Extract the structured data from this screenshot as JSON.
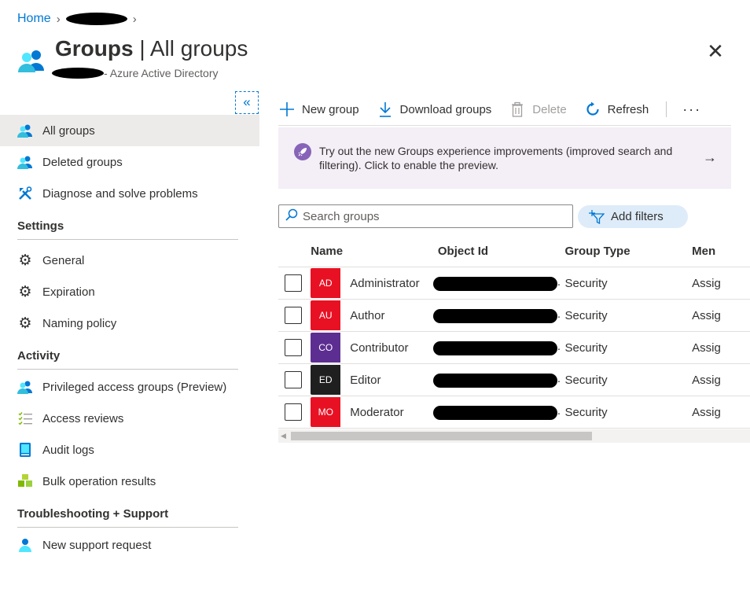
{
  "breadcrumb": {
    "home": "Home"
  },
  "header": {
    "title_bold": "Groups",
    "title_rest": " | All groups",
    "subtitle": " - Azure Active Directory"
  },
  "sidebar": {
    "collapse_glyph": "«",
    "items_top": [
      {
        "label": "All groups",
        "icon": "groups-icon",
        "active": true
      },
      {
        "label": "Deleted groups",
        "icon": "groups-icon"
      },
      {
        "label": "Diagnose and solve problems",
        "icon": "wrench-icon"
      }
    ],
    "settings_heading": "Settings",
    "settings_items": [
      {
        "label": "General",
        "icon": "gear-icon"
      },
      {
        "label": "Expiration",
        "icon": "gear-icon"
      },
      {
        "label": "Naming policy",
        "icon": "gear-icon"
      }
    ],
    "activity_heading": "Activity",
    "activity_items": [
      {
        "label": "Privileged access groups (Preview)",
        "icon": "groups-icon"
      },
      {
        "label": "Access reviews",
        "icon": "checklist-icon"
      },
      {
        "label": "Audit logs",
        "icon": "book-icon"
      },
      {
        "label": "Bulk operation results",
        "icon": "cubes-icon"
      }
    ],
    "support_heading": "Troubleshooting + Support",
    "support_items": [
      {
        "label": "New support request",
        "icon": "person-icon"
      }
    ]
  },
  "toolbar": {
    "new_group": "New group",
    "download_groups": "Download groups",
    "delete": "Delete",
    "refresh": "Refresh",
    "more": "···"
  },
  "banner": {
    "text": "Try out the new Groups experience improvements (improved search and filtering). Click to enable the preview.",
    "arrow": "→"
  },
  "search": {
    "placeholder": "Search groups"
  },
  "filters": {
    "label": "Add filters"
  },
  "table": {
    "columns": {
      "name": "Name",
      "object_id": "Object Id",
      "group_type": "Group Type",
      "membership": "Men"
    },
    "rows": [
      {
        "initials": "AD",
        "name": "Administrator",
        "type": "Security",
        "membership": "Assig",
        "color": "#e81123"
      },
      {
        "initials": "AU",
        "name": "Author",
        "type": "Security",
        "membership": "Assig",
        "color": "#e81123"
      },
      {
        "initials": "CO",
        "name": "Contributor",
        "type": "Security",
        "membership": "Assig",
        "color": "#5c2e91"
      },
      {
        "initials": "ED",
        "name": "Editor",
        "type": "Security",
        "membership": "Assig",
        "color": "#1f1f1f"
      },
      {
        "initials": "MO",
        "name": "Moderator",
        "type": "Security",
        "membership": "Assig",
        "color": "#e81123"
      }
    ],
    "truncation": "."
  },
  "colors": {
    "accent": "#0078d4",
    "banner_bg": "#f4eef7",
    "rocket": "#8764b8"
  }
}
